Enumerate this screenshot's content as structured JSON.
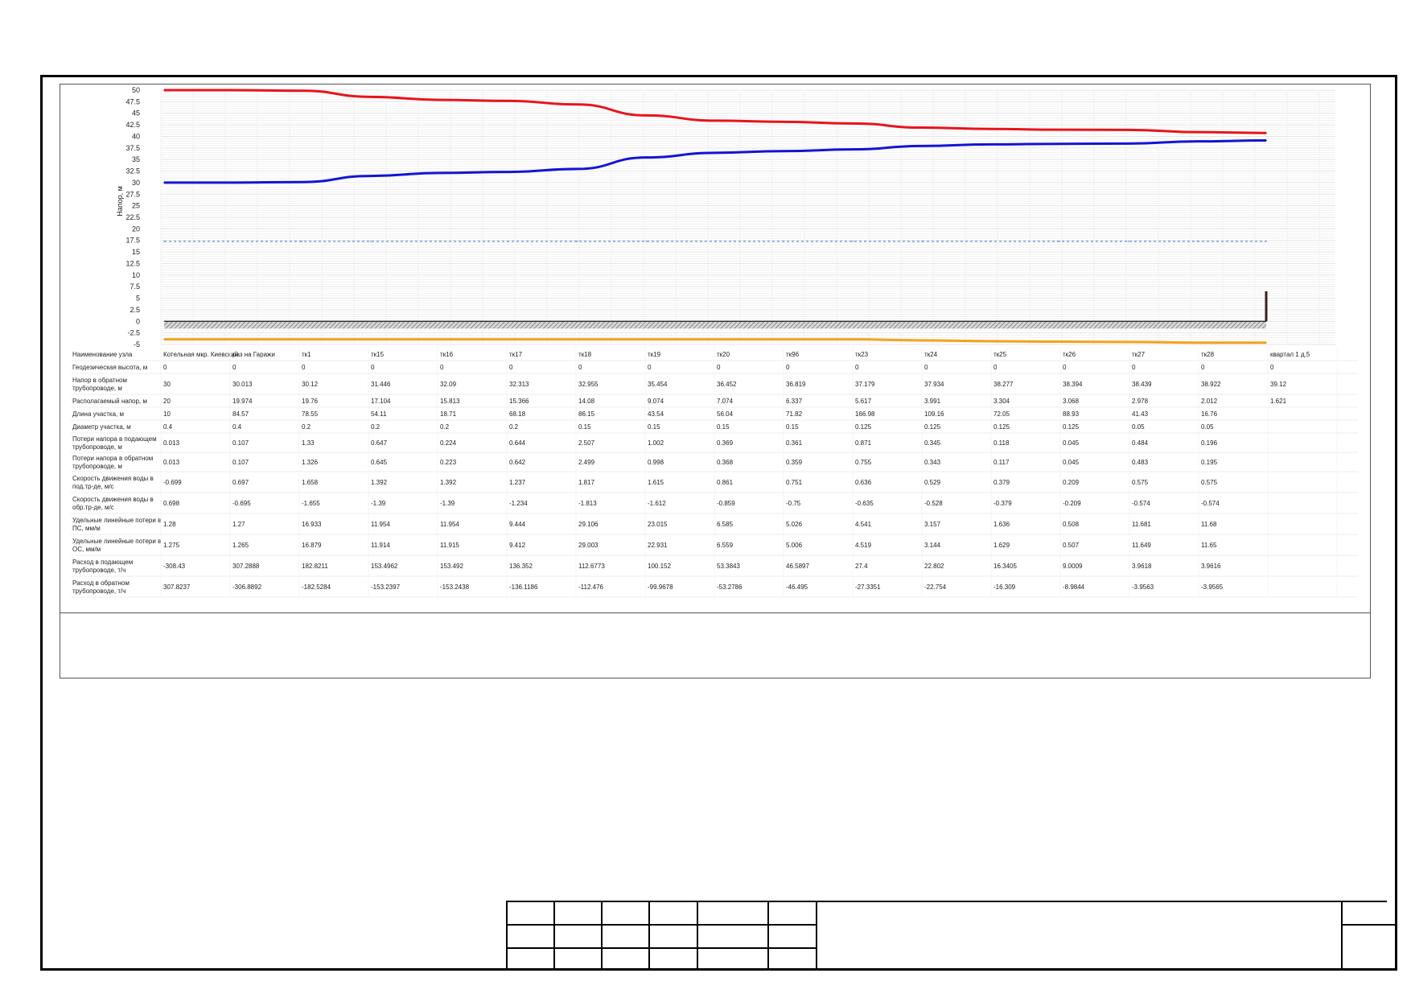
{
  "chart_data": {
    "type": "line",
    "ylabel": "Напор, м",
    "ylim": [
      -5,
      50
    ],
    "yticks": [
      50,
      47.5,
      45,
      42.5,
      40,
      37.5,
      35,
      32.5,
      30,
      27.5,
      25,
      22.5,
      20,
      17.5,
      15,
      12.5,
      10,
      7.5,
      5,
      2.5,
      0,
      -2.5,
      -5
    ],
    "nodes": [
      "Котельная мкр. Киевский",
      "раз на Гаражи",
      "тк1",
      "тк15",
      "тк16",
      "тк17",
      "тк18",
      "тк19",
      "тк20",
      "тк96",
      "тк23",
      "тк24",
      "тк25",
      "тк26",
      "тк27",
      "тк28",
      "квартал 1 д.5"
    ],
    "series": [
      {
        "color": "#e8141b",
        "values": [
          50,
          50,
          49.88,
          48.55,
          47.9,
          47.68,
          46.9,
          44.53,
          43.4,
          43.15,
          42.8,
          41.9,
          41.6,
          41.45,
          41.4,
          40.93,
          40.74
        ]
      },
      {
        "color": "#1414d2",
        "values": [
          30,
          30.01,
          30.12,
          31.45,
          32.09,
          32.31,
          32.96,
          35.45,
          36.45,
          36.82,
          37.18,
          37.93,
          38.28,
          38.39,
          38.44,
          38.92,
          39.12
        ]
      },
      {
        "color": "#5a8fd6",
        "style": "dashed",
        "values": [
          17.3,
          17.3,
          17.3,
          17.3,
          17.3,
          17.3,
          17.3,
          17.3,
          17.3,
          17.3,
          17.3,
          17.3,
          17.3,
          17.3,
          17.3,
          17.3,
          17.3
        ]
      },
      {
        "color": "#f2a31b",
        "values": [
          -3.9,
          -3.9,
          -3.9,
          -3.9,
          -3.9,
          -3.9,
          -3.9,
          -3.9,
          -3.9,
          -3.9,
          -3.9,
          -4.1,
          -4.3,
          -4.4,
          -4.45,
          -4.6,
          -4.6
        ]
      }
    ],
    "ground_level": 0,
    "end_marker_height": 6.5,
    "table": {
      "rows": [
        {
          "label": [
            "Наименование узла"
          ],
          "values": [
            "Котельная мкр. Киевский",
            "раз на Гаражи",
            "тк1",
            "тк15",
            "тк16",
            "тк17",
            "тк18",
            "тк19",
            "тк20",
            "тк96",
            "тк23",
            "тк24",
            "тк25",
            "тк26",
            "тк27",
            "тк28",
            "квартал 1 д.5"
          ]
        },
        {
          "label": [
            "Геодезическая высота, м"
          ],
          "values": [
            "0",
            "0",
            "0",
            "0",
            "0",
            "0",
            "0",
            "0",
            "0",
            "0",
            "0",
            "0",
            "0",
            "0",
            "0",
            "0",
            "0"
          ]
        },
        {
          "label": [
            "Напор в обратном",
            "трубопроводе, м"
          ],
          "values": [
            "30",
            "30.013",
            "30.12",
            "31.446",
            "32.09",
            "32.313",
            "32.955",
            "35.454",
            "36.452",
            "36.819",
            "37.179",
            "37.934",
            "38.277",
            "38.394",
            "38.439",
            "38.922",
            "39.12"
          ]
        },
        {
          "label": [
            "Располагаемый напор, м"
          ],
          "values": [
            "20",
            "19.974",
            "19.76",
            "17.104",
            "15.813",
            "15.366",
            "14.08",
            "9.074",
            "7.074",
            "6.337",
            "5.617",
            "3.991",
            "3.304",
            "3.068",
            "2.978",
            "2.012",
            "1.621"
          ]
        },
        {
          "label": [
            "Длина участка, м"
          ],
          "values": [
            "10",
            "84.57",
            "78.55",
            "54.11",
            "18.71",
            "68.18",
            "86.15",
            "43.54",
            "56.04",
            "71.82",
            "166.98",
            "109.16",
            "72.05",
            "88.93",
            "41.43",
            "16.76",
            ""
          ]
        },
        {
          "label": [
            "Диаметр участка, м"
          ],
          "values": [
            "0.4",
            "0.4",
            "0.2",
            "0.2",
            "0.2",
            "0.2",
            "0.15",
            "0.15",
            "0.15",
            "0.15",
            "0.125",
            "0.125",
            "0.125",
            "0.125",
            "0.05",
            "0.05",
            ""
          ]
        },
        {
          "label": [
            "Потери напора в подающем",
            "трубопроводе, м"
          ],
          "values": [
            "0.013",
            "0.107",
            "1.33",
            "0.647",
            "0.224",
            "0.644",
            "2.507",
            "1.002",
            "0.369",
            "0.361",
            "0.871",
            "0.345",
            "0.118",
            "0.045",
            "0.484",
            "0.196",
            ""
          ]
        },
        {
          "label": [
            "Потери напора в обратном",
            "трубопроводе, м"
          ],
          "values": [
            "0.013",
            "0.107",
            "1.326",
            "0.645",
            "0.223",
            "0.642",
            "2.499",
            "0.998",
            "0.368",
            "0.359",
            "0.755",
            "0.343",
            "0.117",
            "0.045",
            "0.483",
            "0.195",
            ""
          ]
        },
        {
          "label": [
            "Скорость движения воды в",
            "под.тр-де, м/с"
          ],
          "values": [
            "-0.699",
            "0.697",
            "1.658",
            "1.392",
            "1.392",
            "1.237",
            "1.817",
            "1.615",
            "0.861",
            "0.751",
            "0.636",
            "0.529",
            "0.379",
            "0.209",
            "0.575",
            "0.575",
            ""
          ]
        },
        {
          "label": [
            "Скорость движения воды в",
            "обр.тр-де, м/с"
          ],
          "values": [
            "0.698",
            "-0.695",
            "-1.655",
            "-1.39",
            "-1.39",
            "-1.234",
            "-1.813",
            "-1.612",
            "-0.859",
            "-0.75",
            "-0.635",
            "-0.528",
            "-0.379",
            "-0.209",
            "-0.574",
            "-0.574",
            ""
          ]
        },
        {
          "label": [
            "Удельные линейные потери в",
            "ПС, мм/м"
          ],
          "values": [
            "1.28",
            "1.27",
            "16.933",
            "11.954",
            "11.954",
            "9.444",
            "29.106",
            "23.015",
            "6.585",
            "5.026",
            "4.541",
            "3.157",
            "1.636",
            "0.508",
            "11.681",
            "11.68",
            ""
          ]
        },
        {
          "label": [
            "Удельные линейные потери в",
            "ОС, мм/м"
          ],
          "values": [
            "1.275",
            "1.265",
            "16.879",
            "11.914",
            "11.915",
            "9.412",
            "29.003",
            "22.931",
            "6.559",
            "5.006",
            "4.519",
            "3.144",
            "1.629",
            "0.507",
            "11.649",
            "11.65",
            ""
          ]
        },
        {
          "label": [
            "Расход в подающем",
            "трубопроводе, т/ч"
          ],
          "values": [
            "-308.43",
            "307.2888",
            "182.8211",
            "153.4962",
            "153.492",
            "136.352",
            "112.6773",
            "100.152",
            "53.3843",
            "46.5897",
            "27.4",
            "22.802",
            "16.3405",
            "9.0009",
            "3.9618",
            "3.9616",
            ""
          ]
        },
        {
          "label": [
            "Расход в обратном",
            "трубопроводе, т/ч"
          ],
          "values": [
            "307.8237",
            "-306.8892",
            "-182.5284",
            "-153.2397",
            "-153.2438",
            "-136.1186",
            "-112.476",
            "-99.9678",
            "-53.2786",
            "-46.495",
            "-27.3351",
            "-22.754",
            "-16.309",
            "-8.9844",
            "-3.9563",
            "-3.9565",
            ""
          ]
        }
      ]
    }
  }
}
